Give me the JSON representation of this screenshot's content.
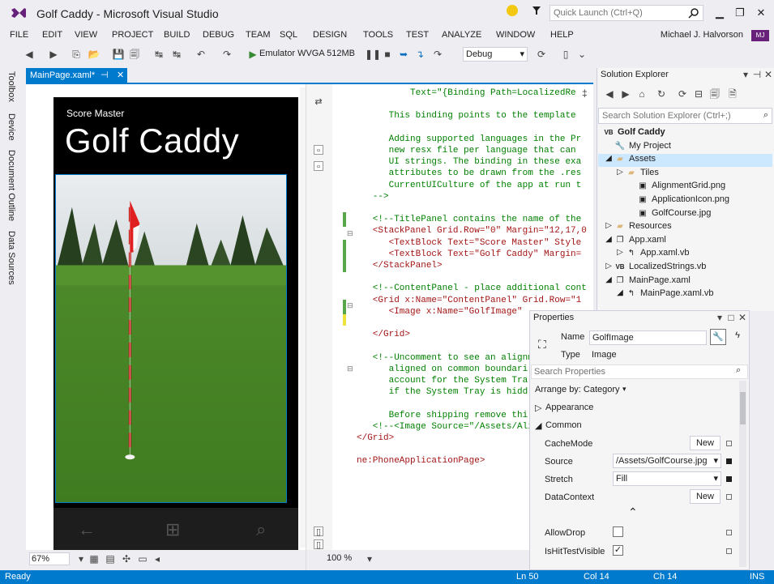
{
  "window": {
    "title": "Golf Caddy - Microsoft Visual Studio",
    "quick_launch_placeholder": "Quick Launch (Ctrl+Q)",
    "user_name": "Michael J. Halvorson",
    "user_badge": "MJ"
  },
  "menu": [
    "FILE",
    "EDIT",
    "VIEW",
    "PROJECT",
    "BUILD",
    "DEBUG",
    "TEAM",
    "SQL",
    "DESIGN",
    "TOOLS",
    "TEST",
    "ANALYZE",
    "WINDOW",
    "HELP"
  ],
  "toolbar": {
    "emulator": "Emulator WVGA 512MB",
    "config": "Debug"
  },
  "left_tabs": [
    "Toolbox",
    "Device",
    "Document Outline",
    "Data Sources"
  ],
  "editor": {
    "tab_label": "MainPage.xaml*",
    "designer_zoom": "67%",
    "xaml_zoom": "100 %"
  },
  "phone": {
    "app_name": "Score Master",
    "page_title": "Golf Caddy"
  },
  "xaml_lines": [
    {
      "text": "          Text=\"{Binding Path=LocalizedRe",
      "cls": "c-comment"
    },
    {
      "text": "",
      "cls": ""
    },
    {
      "text": "      This binding points to the template",
      "cls": "c-comment"
    },
    {
      "text": "",
      "cls": ""
    },
    {
      "text": "      Adding supported languages in the Pr",
      "cls": "c-comment"
    },
    {
      "text": "      new resx file per language that can",
      "cls": "c-comment"
    },
    {
      "text": "      UI strings. The binding in these exa",
      "cls": "c-comment"
    },
    {
      "text": "      attributes to be drawn from the .res",
      "cls": "c-comment"
    },
    {
      "text": "      CurrentUICulture of the app at run t",
      "cls": "c-comment"
    },
    {
      "text": "   -->",
      "cls": "c-comment"
    },
    {
      "text": "",
      "cls": ""
    },
    {
      "text": "   <!--TitlePanel contains the name of the",
      "cls": "c-comment"
    },
    {
      "text": "   <StackPanel Grid.Row=\"0\" Margin=\"12,17,0",
      "cls": "c-tag"
    },
    {
      "text": "      <TextBlock Text=\"Score Master\" Style",
      "cls": "c-tag"
    },
    {
      "text": "      <TextBlock Text=\"Golf Caddy\" Margin=",
      "cls": "c-tag"
    },
    {
      "text": "   </StackPanel>",
      "cls": "c-tag"
    },
    {
      "text": "",
      "cls": ""
    },
    {
      "text": "   <!--ContentPanel - place additional cont",
      "cls": "c-comment"
    },
    {
      "text": "   <Grid x:Name=\"ContentPanel\" Grid.Row=\"1",
      "cls": "c-tag"
    },
    {
      "text": "      <Image x:Name=\"GolfImage\"",
      "cls": "c-tag"
    },
    {
      "text": "",
      "cls": ""
    },
    {
      "text": "   </Grid>",
      "cls": "c-tag"
    },
    {
      "text": "",
      "cls": ""
    },
    {
      "text": "   <!--Uncomment to see an alignm",
      "cls": "c-comment"
    },
    {
      "text": "      aligned on common boundari",
      "cls": "c-comment"
    },
    {
      "text": "      account for the System Tra",
      "cls": "c-comment"
    },
    {
      "text": "      if the System Tray is hidd",
      "cls": "c-comment"
    },
    {
      "text": "",
      "cls": ""
    },
    {
      "text": "      Before shipping remove thi",
      "cls": "c-comment"
    },
    {
      "text": "   <!--<Image Source=\"/Assets/Ali",
      "cls": "c-comment"
    },
    {
      "text": "</Grid>",
      "cls": "c-tag"
    },
    {
      "text": "",
      "cls": ""
    },
    {
      "text": "ne:PhoneApplicationPage>",
      "cls": "c-tag"
    }
  ],
  "solution": {
    "header": "Solution Explorer",
    "search_placeholder": "Search Solution Explorer (Ctrl+;)",
    "items": [
      {
        "label": "Golf Caddy",
        "icon": "VB",
        "indent": 0,
        "bold": true
      },
      {
        "label": "My Project",
        "icon": "🔧",
        "indent": 1
      },
      {
        "label": "Assets",
        "icon": "▰",
        "indent": 1,
        "expander": "◢"
      },
      {
        "label": "Tiles",
        "icon": "▰",
        "indent": 2,
        "expander": "▷"
      },
      {
        "label": "AlignmentGrid.png",
        "icon": "▣",
        "indent": 3
      },
      {
        "label": "ApplicationIcon.png",
        "icon": "▣",
        "indent": 3
      },
      {
        "label": "GolfCourse.jpg",
        "icon": "▣",
        "indent": 3
      },
      {
        "label": "Resources",
        "icon": "▰",
        "indent": 1,
        "expander": "▷"
      },
      {
        "label": "App.xaml",
        "icon": "❐",
        "indent": 1,
        "expander": "◢"
      },
      {
        "label": "App.xaml.vb",
        "icon": "↰",
        "indent": 2,
        "expander": "▷"
      },
      {
        "label": "LocalizedStrings.vb",
        "icon": "VB",
        "indent": 1,
        "expander": "▷"
      },
      {
        "label": "MainPage.xaml",
        "icon": "❐",
        "indent": 1,
        "expander": "◢"
      },
      {
        "label": "MainPage.xaml.vb",
        "icon": "↰",
        "indent": 2,
        "expander": "◢"
      }
    ]
  },
  "properties": {
    "header": "Properties",
    "name_label": "Name",
    "name_value": "GolfImage",
    "type_label": "Type",
    "type_value": "Image",
    "search_placeholder": "Search Properties",
    "arrange_by": "Arrange by: Category",
    "cat_appearance": "Appearance",
    "cat_common": "Common",
    "rows": {
      "cachemode": "CacheMode",
      "source": "Source",
      "source_value": "/Assets/GolfCourse.jpg",
      "stretch": "Stretch",
      "stretch_value": "Fill",
      "datacontext": "DataContext",
      "allowdrop": "AllowDrop",
      "hittest": "IsHitTestVisible",
      "new_label": "New"
    }
  },
  "status": {
    "ready": "Ready",
    "ln": "Ln 50",
    "col": "Col 14",
    "ch": "Ch 14",
    "ins": "INS"
  }
}
